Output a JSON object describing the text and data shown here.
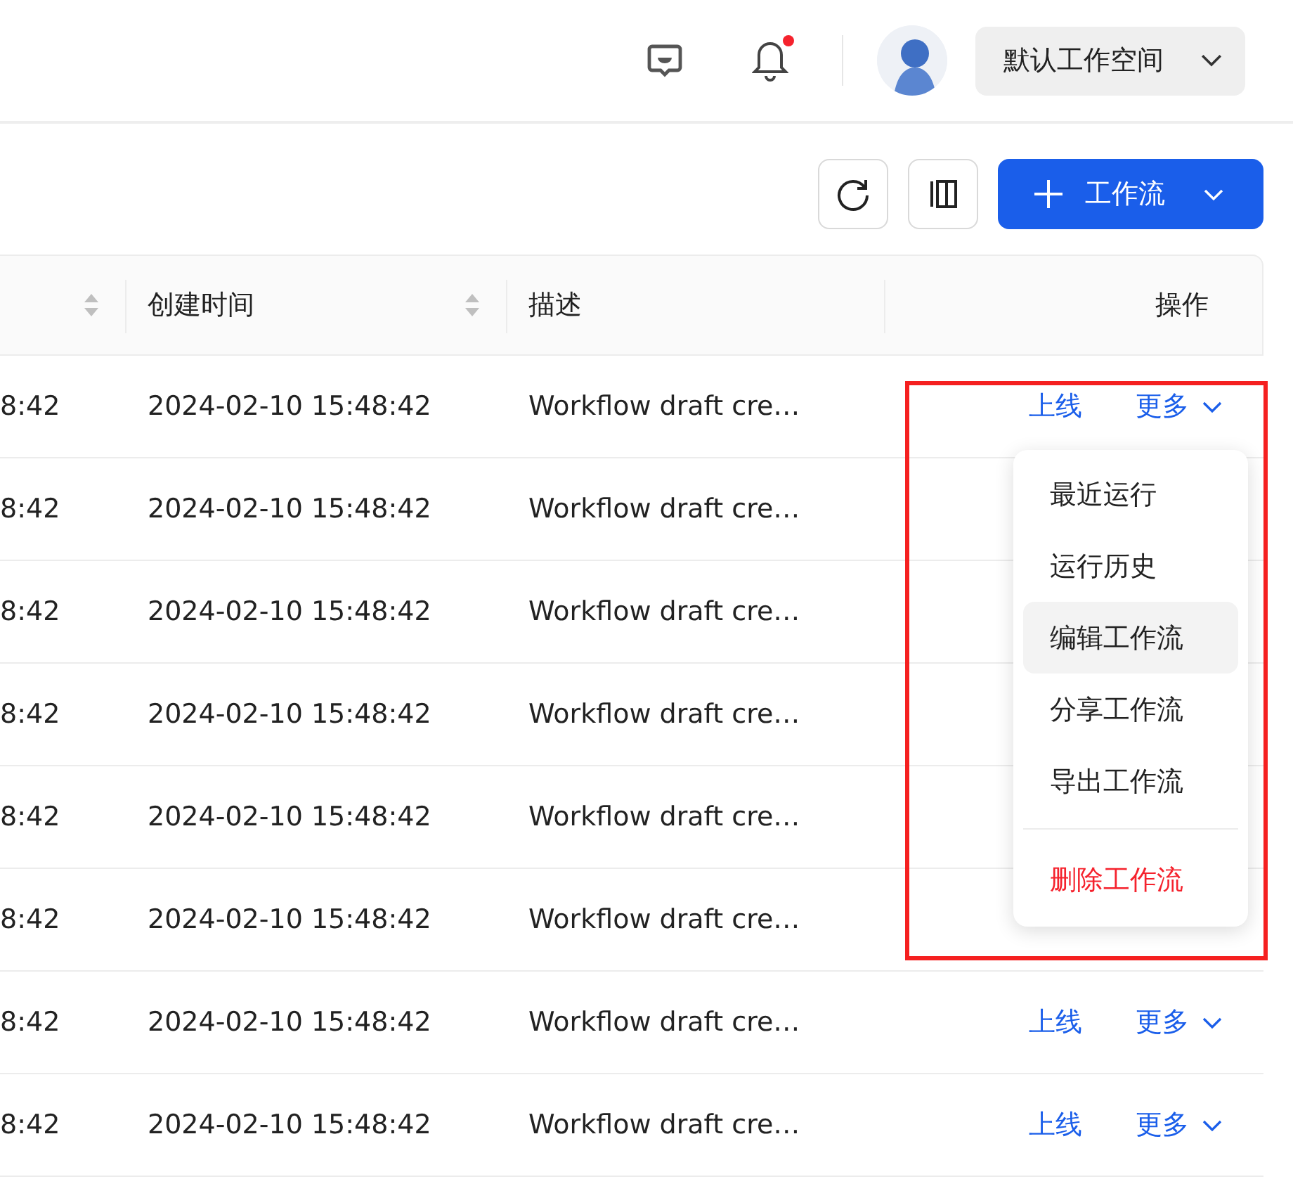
{
  "header": {
    "notifications": {
      "unread": true
    },
    "workspace": {
      "label": "默认工作空间"
    }
  },
  "toolbar": {
    "new_button": {
      "label": "工作流"
    }
  },
  "table": {
    "columns": [
      {
        "sortable": true
      },
      {
        "label": "创建时间",
        "sortable": true
      },
      {
        "label": "描述",
        "sortable": false
      },
      {
        "label": "操作",
        "sortable": false
      }
    ],
    "rows": [
      {
        "column_1": "8:42",
        "created": "2024-02-10 15:48:42",
        "description": "Workflow draft cre…",
        "actions": {
          "online": "上线",
          "more": "更多"
        }
      },
      {
        "column_1": "8:42",
        "created": "2024-02-10 15:48:42",
        "description": "Workflow draft cre…"
      },
      {
        "column_1": "8:42",
        "created": "2024-02-10 15:48:42",
        "description": "Workflow draft cre…"
      },
      {
        "column_1": "8:42",
        "created": "2024-02-10 15:48:42",
        "description": "Workflow draft cre…"
      },
      {
        "column_1": "8:42",
        "created": "2024-02-10 15:48:42",
        "description": "Workflow draft cre…"
      },
      {
        "column_1": "8:42",
        "created": "2024-02-10 15:48:42",
        "description": "Workflow draft cre…"
      },
      {
        "column_1": "8:42",
        "created": "2024-02-10 15:48:42",
        "description": "Workflow draft cre…",
        "actions": {
          "online": "上线",
          "more": "更多"
        }
      },
      {
        "column_1": "8:42",
        "created": "2024-02-10 15:48:42",
        "description": "Workflow draft cre…",
        "actions": {
          "online": "上线",
          "more": "更多"
        }
      }
    ]
  },
  "menu": {
    "items": [
      {
        "kind": "normal",
        "label": "最近运行",
        "highlighted": false
      },
      {
        "kind": "normal",
        "label": "运行历史",
        "highlighted": false
      },
      {
        "kind": "normal",
        "label": "编辑工作流",
        "highlighted": true
      },
      {
        "kind": "normal",
        "label": "分享工作流",
        "highlighted": false
      },
      {
        "kind": "normal",
        "label": "导出工作流",
        "highlighted": false
      },
      {
        "kind": "divider"
      },
      {
        "kind": "danger",
        "label": "删除工作流",
        "highlighted": false
      }
    ]
  }
}
